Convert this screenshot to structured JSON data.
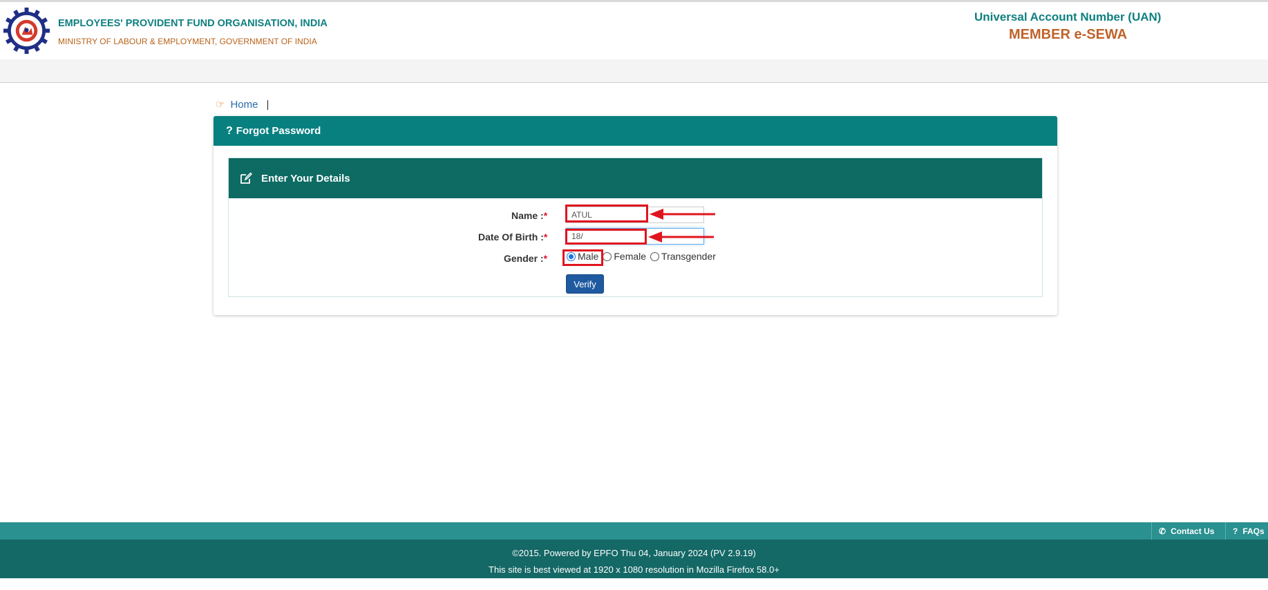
{
  "header": {
    "org_name": "EMPLOYEES' PROVIDENT FUND ORGANISATION, INDIA",
    "ministry": "MINISTRY OF LABOUR & EMPLOYMENT, GOVERNMENT OF INDIA",
    "uan_title": "Universal Account Number (UAN)",
    "portal_name": "MEMBER e-SEWA"
  },
  "breadcrumb": {
    "icon": "hand-pointer-icon",
    "home_label": "Home",
    "separator": "|"
  },
  "panel": {
    "title": "Forgot Password",
    "title_icon": "question-icon"
  },
  "details": {
    "title": "Enter Your Details",
    "title_icon": "edit-icon",
    "name_label": "Name :",
    "name_value": "ATUL",
    "dob_label": "Date Of Birth :",
    "dob_value": "18/",
    "gender_label": "Gender :",
    "required_mark": "*",
    "gender_options": [
      "Male",
      "Female",
      "Transgender"
    ],
    "gender_selected": "Male",
    "verify_label": "Verify"
  },
  "footer": {
    "contact_label": "Contact Us",
    "contact_icon": "phone-icon",
    "faq_label": "FAQs",
    "faq_icon": "question-icon",
    "copyright": "©2015. Powered by EPFO Thu 04, January 2024 (PV 2.9.19)",
    "best_viewed": "This site is best viewed at 1920 x 1080 resolution in Mozilla Firefox 58.0+"
  },
  "colors": {
    "teal": "#088080",
    "dark_teal": "#0d6b63",
    "orange": "#c0622a",
    "highlight_red": "#e0141e",
    "button_blue": "#1f5aa0"
  }
}
